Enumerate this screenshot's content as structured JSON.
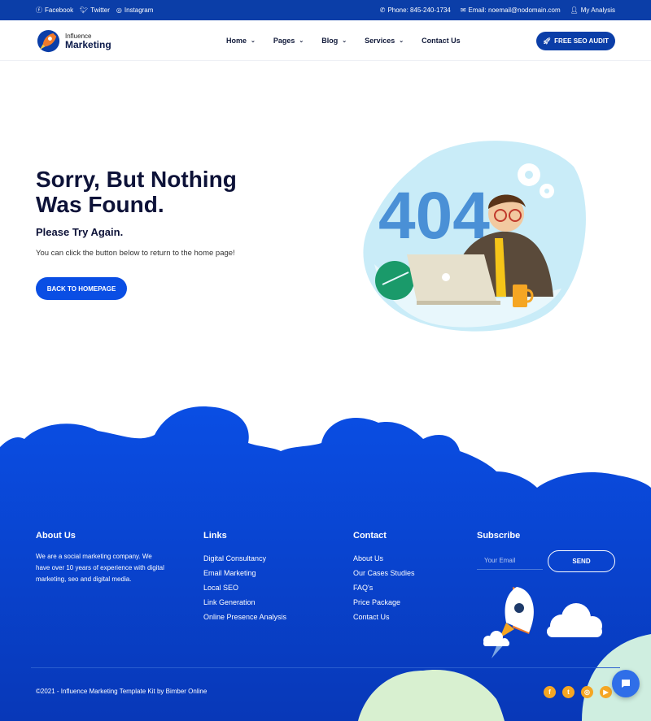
{
  "topbar": {
    "social": [
      {
        "icon": "facebook-icon",
        "glyph": "f",
        "label": "Facebook"
      },
      {
        "icon": "twitter-icon",
        "glyph": "t",
        "label": "Twitter"
      },
      {
        "icon": "instagram-icon",
        "glyph": "◎",
        "label": "Instagram"
      }
    ],
    "phone": "Phone: 845-240-1734",
    "email": "Email: noemail@nodomain.com",
    "account": "My Analysis"
  },
  "header": {
    "logo_small": "Influence",
    "logo_big": "Marketing",
    "nav": [
      {
        "label": "Home",
        "dropdown": true
      },
      {
        "label": "Pages",
        "dropdown": true
      },
      {
        "label": "Blog",
        "dropdown": true
      },
      {
        "label": "Services",
        "dropdown": true
      },
      {
        "label": "Contact Us",
        "dropdown": false
      }
    ],
    "cta": "FREE SEO AUDIT"
  },
  "hero": {
    "title": "Sorry, But Nothing Was Found.",
    "subtitle": "Please Try Again.",
    "text": "You can click the button below to return to the home page!",
    "button": "BACK TO HOMEPAGE",
    "illustration_text": "404"
  },
  "footer": {
    "about_title": "About Us",
    "about_text": "We are a social marketing company. We have over 10 years of experience with digital marketing, seo and digital media.",
    "links_title": "Links",
    "links": [
      "Digital Consultancy",
      "Email Marketing",
      "Local SEO",
      "Link Generation",
      "Online Presence Analysis"
    ],
    "contact_title": "Contact",
    "contact_links": [
      "About Us",
      "Our Cases Studies",
      "FAQ's",
      "Price Package",
      "Contact Us"
    ],
    "subscribe_title": "Subscribe",
    "email_placeholder": "Your Email",
    "send": "SEND",
    "copyright": "©2021 - Influence Marketing Template Kit by Bimber Online",
    "social_icons": [
      "facebook-icon",
      "twitter-icon",
      "instagram-icon",
      "youtube-icon"
    ]
  },
  "colors": {
    "primary": "#0b3ea8",
    "button": "#0a4ee4",
    "accent": "#f5a623",
    "footer": "#0a46d6"
  }
}
